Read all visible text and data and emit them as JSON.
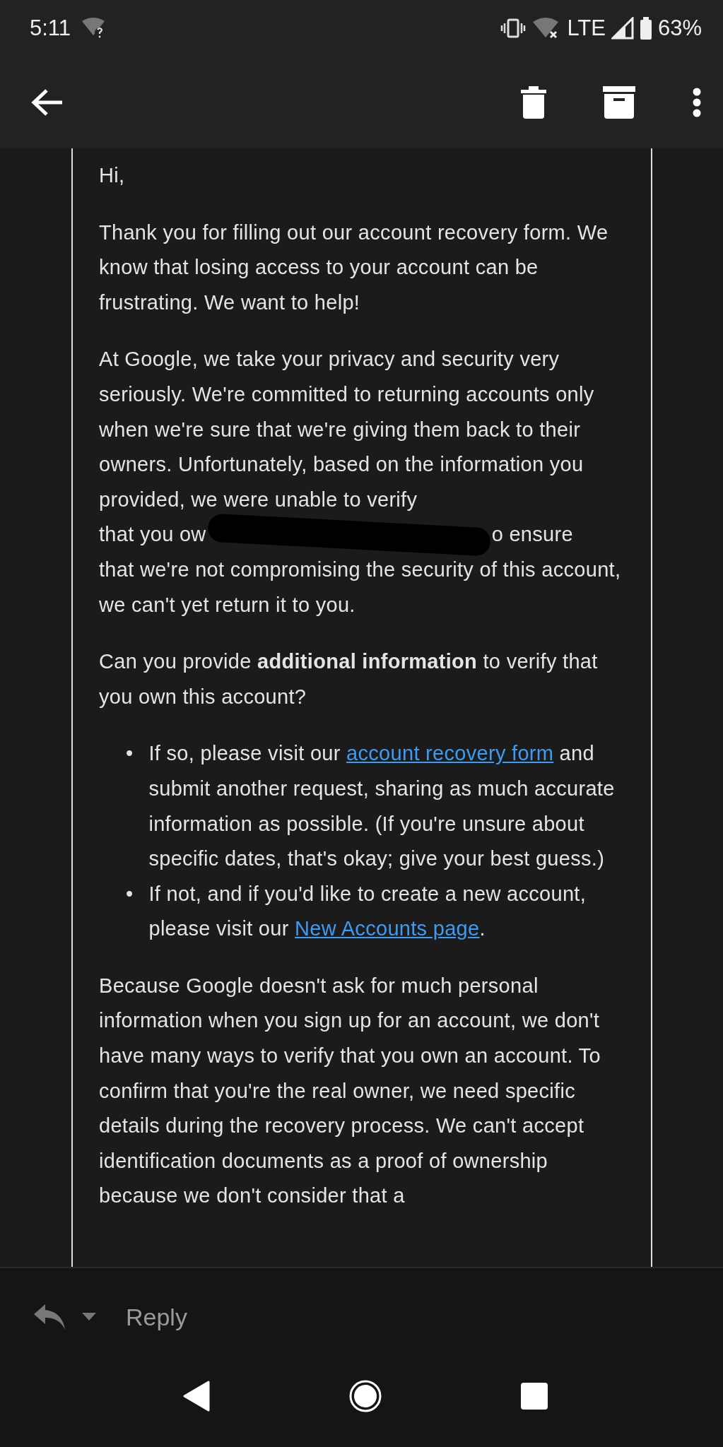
{
  "status_bar": {
    "time": "5:11",
    "network": "LTE",
    "battery": "63%"
  },
  "reply_bar": {
    "label": "Reply"
  },
  "message": {
    "blocks": [
      {
        "kind": "paragraph",
        "text": "Hi,"
      },
      {
        "kind": "paragraph",
        "text": "Thank you for filling out our account recovery form. We know that losing access to your account can be frustrating. We want to help!"
      },
      {
        "kind": "redacted",
        "before": "At Google, we take your privacy and security very seriously. We're committed to returning accounts only when we're sure that we're giving them back to their owners. Unfortunately, based on the information you provided, we were unable to verify",
        "line_start": "that you ow",
        "line_end": "o ensure",
        "after": "that we're not compromising the security of this account, we can't yet return it to you."
      },
      {
        "kind": "paragraph",
        "text": "Can you provide **additional information** to verify that you own this account?"
      },
      {
        "kind": "list",
        "items": [
          {
            "bullet": "•",
            "parts": [
              {
                "text": "If so, please visit our "
              },
              {
                "link": "account recovery form"
              },
              {
                "text": " and submit another request, sharing as much accurate information as possible. (If you're unsure about specific dates, that's okay; give your best guess.)"
              }
            ]
          },
          {
            "bullet": "•",
            "parts": [
              {
                "text": "If not, and if you'd like to create a new account, please visit our "
              },
              {
                "link": "New Accounts page"
              },
              {
                "text": "."
              }
            ]
          }
        ]
      },
      {
        "kind": "paragraph",
        "text": "Because Google doesn't ask for much personal information when you sign up for an account, we don't have many ways to verify that you own an account. To confirm that you're the real owner, we need specific details during the recovery process. We can't accept identification documents as a proof of ownership because we don't consider that a"
      }
    ]
  }
}
